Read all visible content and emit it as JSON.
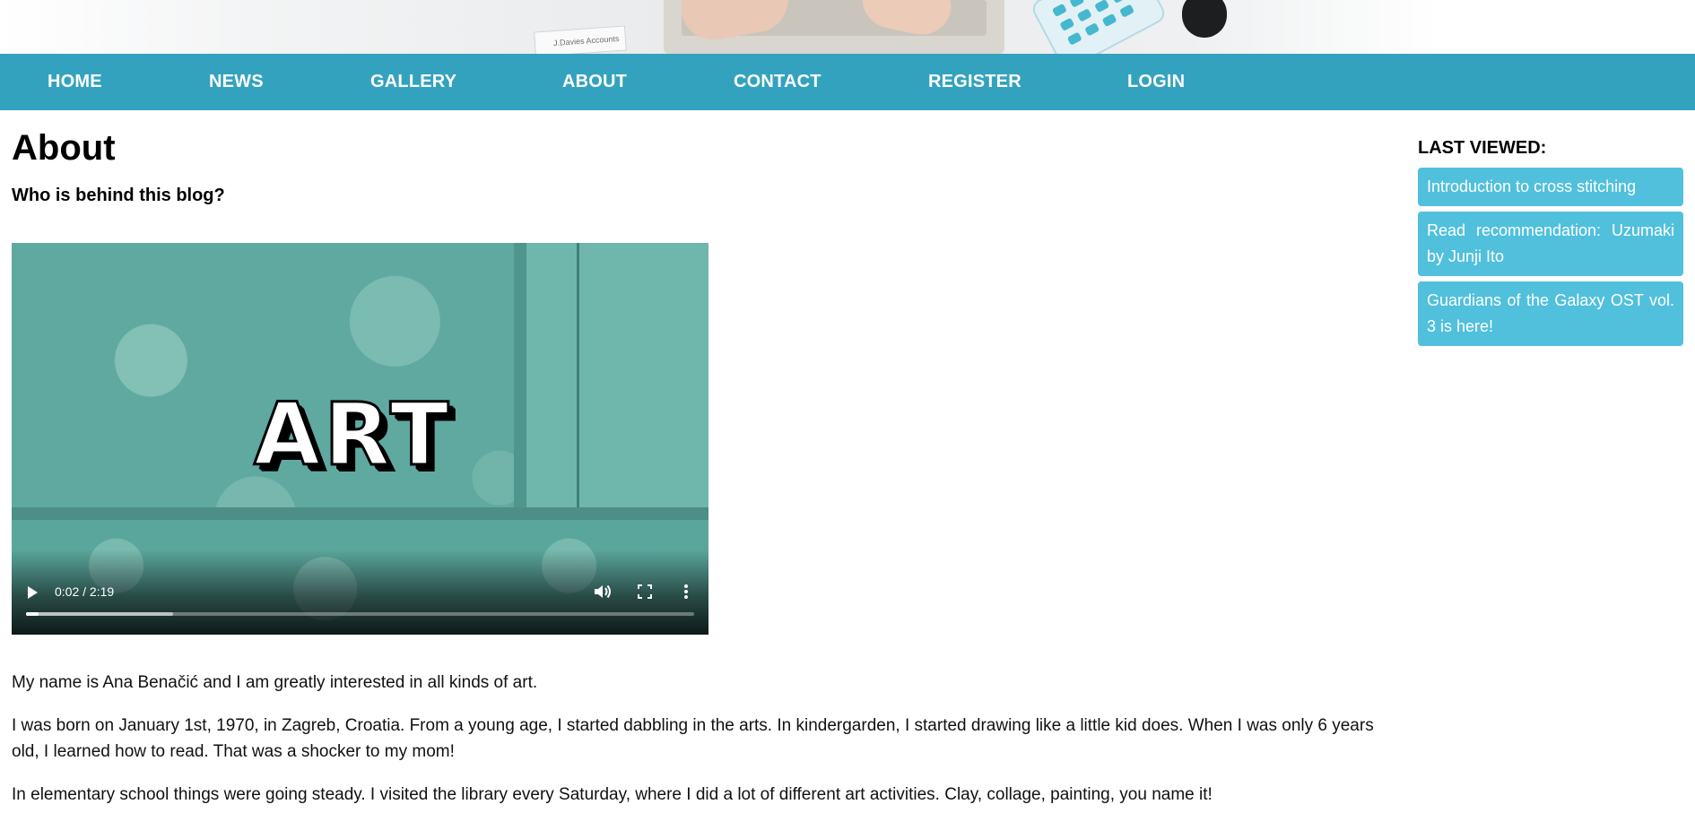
{
  "banner": {
    "card_text": "J.Davies Accounts"
  },
  "nav": {
    "items": [
      {
        "label": "HOME"
      },
      {
        "label": "NEWS"
      },
      {
        "label": "GALLERY"
      },
      {
        "label": "ABOUT"
      },
      {
        "label": "CONTACT"
      },
      {
        "label": "REGISTER"
      },
      {
        "label": "LOGIN"
      }
    ],
    "color": "#33a2bf"
  },
  "page": {
    "title": "About",
    "subtitle": "Who is behind this blog?"
  },
  "video": {
    "title_text": "ART",
    "time": "0:02 / 2:19",
    "played_fraction": 0.015,
    "buffered_fraction": 0.22,
    "icons": [
      "play-icon",
      "volume-icon",
      "fullscreen-icon",
      "more-options-icon"
    ]
  },
  "paragraphs": [
    "My name is Ana Benačić and I am greatly interested in all kinds of art.",
    "I was born on January 1st, 1970, in Zagreb, Croatia. From a young age, I started dabbling in the arts. In kindergarden, I started drawing like a little kid does. When I was only 6 years old, I learned how to read. That was a shocker to my mom!",
    "In elementary school things were going steady. I visited the library every Saturday, where I did a lot of different art activities. Clay, collage, painting, you name it!"
  ],
  "sidebar": {
    "heading": "LAST VIEWED:",
    "items": [
      {
        "label": "Introduction to cross stitching"
      },
      {
        "label": "Read recommendation: Uzumaki by Junji Ito"
      },
      {
        "label": "Guardians of the Galaxy OST vol. 3 is here!"
      }
    ],
    "item_color": "#51c0dc"
  }
}
